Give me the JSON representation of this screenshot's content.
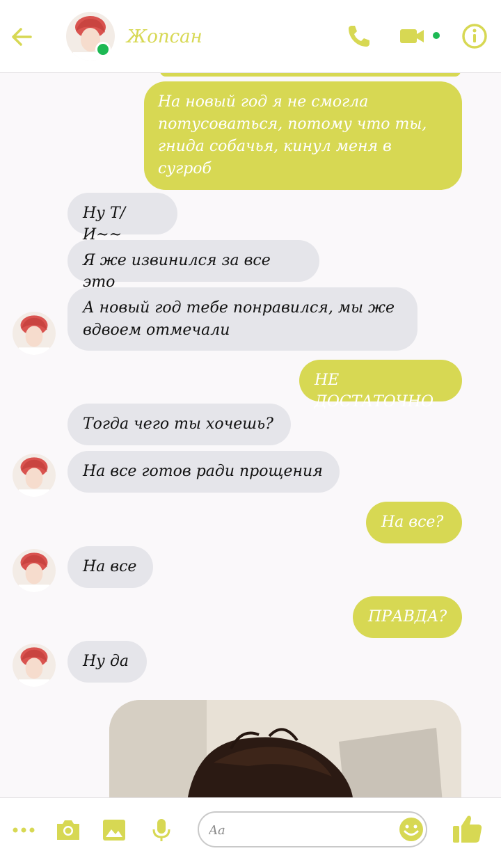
{
  "header": {
    "contact_name": "Жопсан"
  },
  "theme": {
    "accent": "#d7d853",
    "incoming_bg": "#e5e5ea",
    "online": "#1db954"
  },
  "messages": [
    {
      "from": "me",
      "text": "На новый год я не смогла потусоваться, потому что ты, гнида собачья, кинул меня в сугроб"
    },
    {
      "from": "them",
      "text": "Ну Т/И~~"
    },
    {
      "from": "them",
      "text": "Я же извинился за все это"
    },
    {
      "from": "them",
      "text": "А новый год тебе понравился, мы же вдвоем отмечали"
    },
    {
      "from": "me",
      "text": "НЕ ДОСТАТОЧНО"
    },
    {
      "from": "them",
      "text": "Тогда чего ты хочешь?"
    },
    {
      "from": "them",
      "text": "На все готов ради прощения"
    },
    {
      "from": "me",
      "text": "На все?"
    },
    {
      "from": "them",
      "text": "На все"
    },
    {
      "from": "me",
      "text": "ПРАВДА?"
    },
    {
      "from": "them",
      "text": "Ну да"
    }
  ],
  "composer": {
    "placeholder": "Aa"
  },
  "icons": [
    "back-arrow-icon",
    "phone-icon",
    "video-camera-icon",
    "info-icon",
    "more-icon",
    "camera-icon",
    "image-icon",
    "microphone-icon",
    "emoji-icon",
    "thumbs-up-icon"
  ]
}
